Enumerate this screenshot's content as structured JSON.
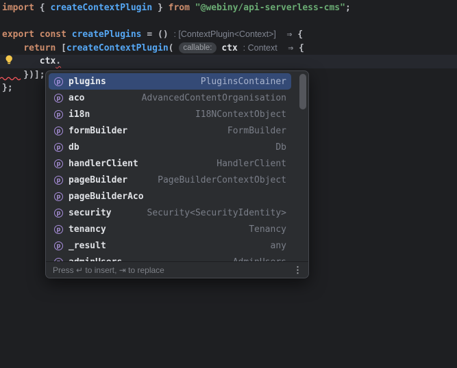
{
  "colors": {
    "editor_background": "#1E1F22",
    "caret_line": "#26282E",
    "keyword": "#CF8E6D",
    "function_name": "#56A8F5",
    "string": "#6AAB73",
    "default_text": "#BCBEC4",
    "inlay_hint": "#808591",
    "error_red": "#F2555A",
    "selection_blue": "#344A76",
    "property_icon_purple": "#A98EDE",
    "popup_background": "#2B2D30"
  },
  "editor": {
    "code_lines": [
      {
        "tokens": [
          {
            "t": "import",
            "c": "kw"
          },
          {
            "t": " { ",
            "c": "def"
          },
          {
            "t": "createContextPlugin",
            "c": "fn"
          },
          {
            "t": " } ",
            "c": "def"
          },
          {
            "t": "from",
            "c": "kw"
          },
          {
            "t": " ",
            "c": "def"
          },
          {
            "t": "\"@webiny/api-serverless-cms\"",
            "c": "str"
          },
          {
            "t": ";",
            "c": "def"
          }
        ]
      },
      {
        "tokens": []
      },
      {
        "tokens": [
          {
            "t": "export",
            "c": "kw"
          },
          {
            "t": " ",
            "c": "def"
          },
          {
            "t": "const",
            "c": "kw"
          },
          {
            "t": " ",
            "c": "def"
          },
          {
            "t": "createPlugins",
            "c": "fn"
          },
          {
            "t": " = () ",
            "c": "def"
          },
          {
            "t": ": [ContextPlugin<Context>]",
            "c": "hint"
          },
          {
            "t": "  ",
            "c": "def"
          },
          {
            "t": "⇒",
            "c": "arr"
          },
          {
            "t": " {",
            "c": "def"
          }
        ]
      },
      {
        "tokens": [
          {
            "t": "    ",
            "c": "def"
          },
          {
            "t": "return",
            "c": "kw"
          },
          {
            "t": " [",
            "c": "def"
          },
          {
            "t": "createContextPlugin",
            "c": "fn"
          },
          {
            "t": "( ",
            "c": "def"
          },
          {
            "t": "callable:",
            "c": "chip"
          },
          {
            "t": " ",
            "c": "def"
          },
          {
            "t": "ctx",
            "c": "var"
          },
          {
            "t": " ",
            "c": "def"
          },
          {
            "t": ": Context",
            "c": "hint"
          },
          {
            "t": "  ",
            "c": "def"
          },
          {
            "t": "⇒",
            "c": "arr"
          },
          {
            "t": " {",
            "c": "def"
          }
        ]
      },
      {
        "tokens": [
          {
            "t": "       ",
            "c": "def"
          },
          {
            "t": "ctx",
            "c": "var"
          },
          {
            "t": ".",
            "c": "err"
          }
        ]
      },
      {
        "tokens": [
          {
            "t": "    })];",
            "c": "def"
          }
        ]
      },
      {
        "tokens": [
          {
            "t": "};",
            "c": "def"
          }
        ]
      }
    ]
  },
  "popup": {
    "icon_letter": "p",
    "items": [
      {
        "label": "plugins",
        "type": "PluginsContainer",
        "selected": true
      },
      {
        "label": "aco",
        "type": "AdvancedContentOrganisation",
        "selected": false
      },
      {
        "label": "i18n",
        "type": "I18NContextObject",
        "selected": false
      },
      {
        "label": "formBuilder",
        "type": "FormBuilder",
        "selected": false
      },
      {
        "label": "db",
        "type": "Db",
        "selected": false
      },
      {
        "label": "handlerClient",
        "type": "HandlerClient",
        "selected": false
      },
      {
        "label": "pageBuilder",
        "type": "PageBuilderContextObject",
        "selected": false
      },
      {
        "label": "pageBuilderAco",
        "type": "",
        "selected": false
      },
      {
        "label": "security",
        "type": "Security<SecurityIdentity>",
        "selected": false
      },
      {
        "label": "tenancy",
        "type": "Tenancy",
        "selected": false
      },
      {
        "label": "_result",
        "type": "any",
        "selected": false
      },
      {
        "label": "adminUsers",
        "type": "AdminUsers",
        "selected": false
      }
    ],
    "hint": "Press ↵ to insert, ⇥ to replace",
    "more_icon": "⋮"
  }
}
